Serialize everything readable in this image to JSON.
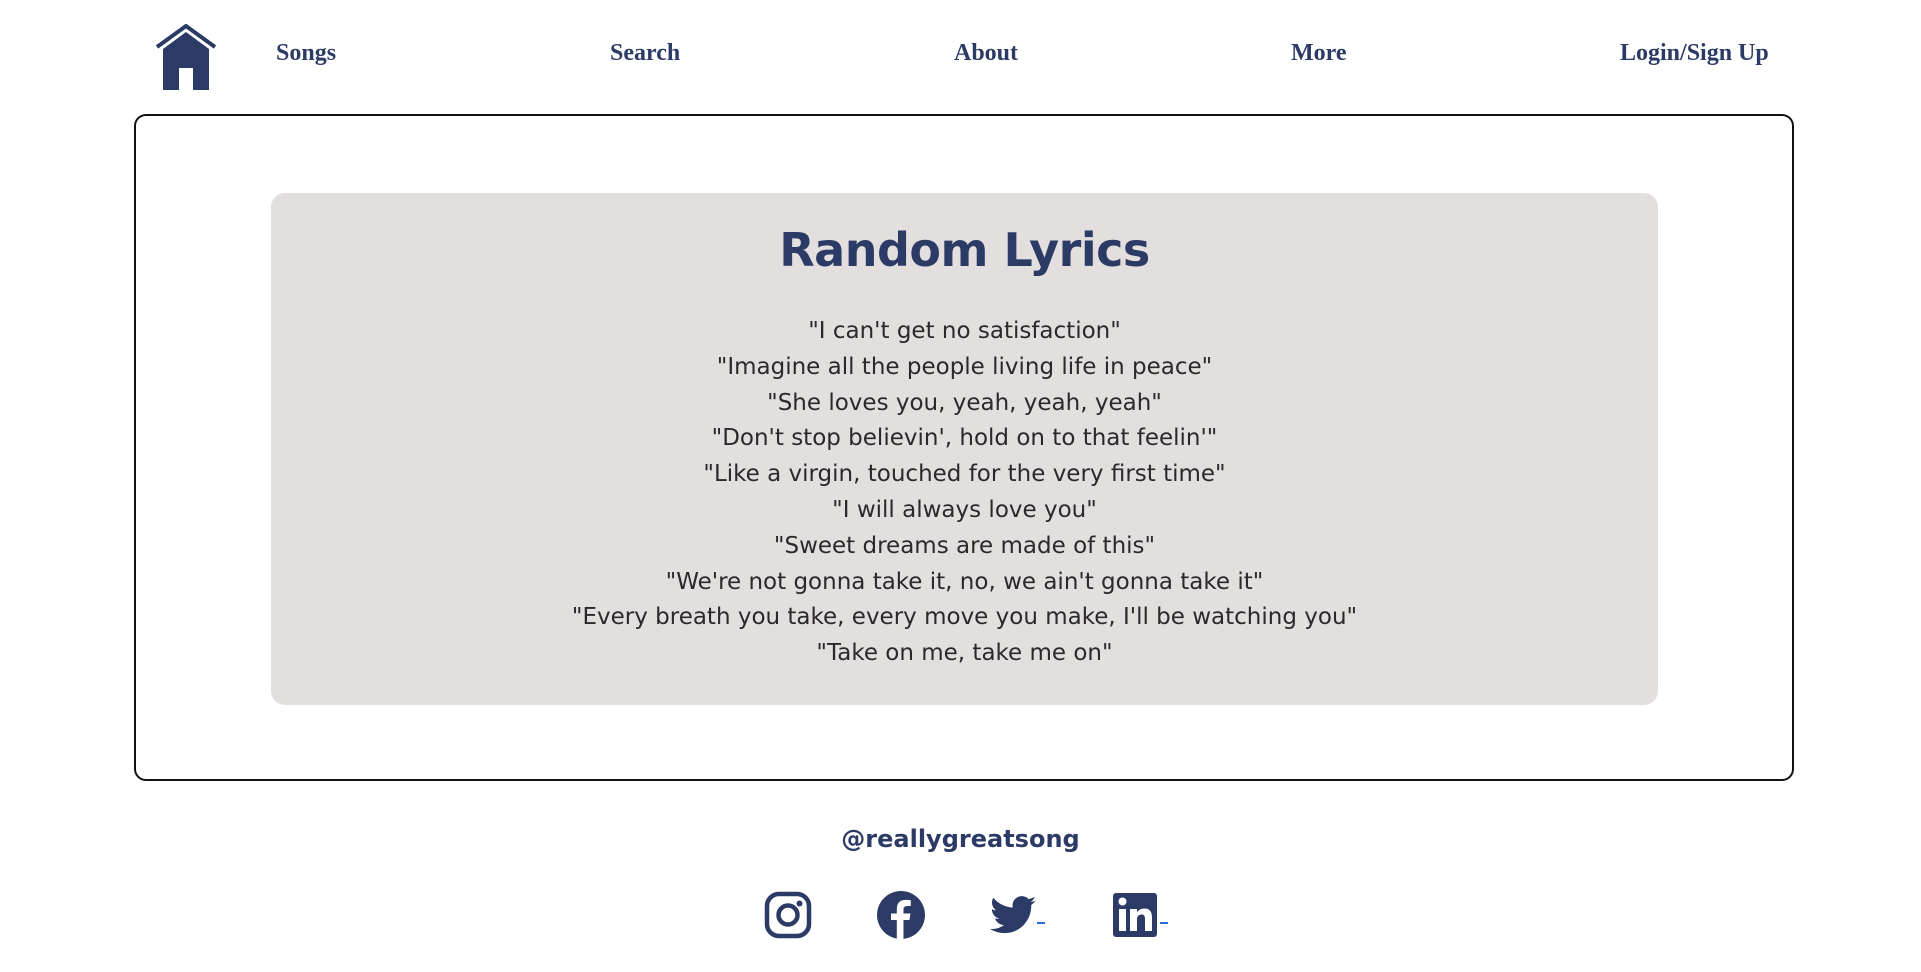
{
  "nav": {
    "home_icon": "home-icon",
    "links": [
      "Songs",
      "Search",
      "About",
      "More",
      "Login/Sign Up"
    ]
  },
  "main": {
    "title": "Random Lyrics",
    "lyrics": [
      "\"I can't get no satisfaction\"",
      "\"Imagine all the people living life in peace\"",
      "\"She loves you, yeah, yeah, yeah\"",
      "\"Don't stop believin', hold on to that feelin'\"",
      "\"Like a virgin, touched for the very first time\"",
      "\"I will always love you\"",
      "\"Sweet dreams are made of this\"",
      "\"We're not gonna take it, no, we ain't gonna take it\"",
      "\"Every breath you take, every move you make, I'll be watching you\"",
      "\"Take on me, take me on\""
    ]
  },
  "footer": {
    "handle": "@reallygreatsong",
    "social_icons": [
      "instagram-icon",
      "facebook-icon",
      "twitter-icon",
      "linkedin-icon"
    ]
  },
  "colors": {
    "primary": "#2c3a66",
    "card_bg": "#e3dfde",
    "link_accent": "#2a6fdb"
  }
}
